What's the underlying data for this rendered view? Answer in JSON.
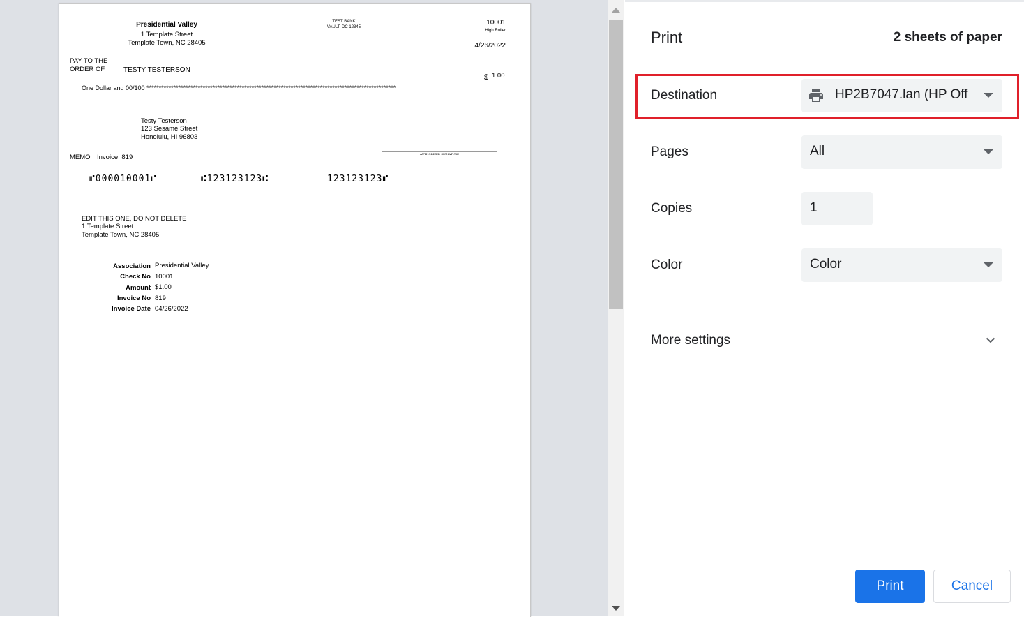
{
  "preview": {
    "association_name": "Presidential Valley",
    "association_street": "1 Template Street",
    "association_city": "Template Town, NC 28405",
    "bank_name": "TEST BANK",
    "bank_city": "VAULT, DC 12345",
    "check_number": "10001",
    "account_note": "High Roller",
    "date": "4/26/2022",
    "pay_to_line1": "PAY TO THE",
    "pay_to_line2": "ORDER OF",
    "payee": "TESTY TESTERSON",
    "dollar_sign": "$",
    "amount": "1.00",
    "amount_words": "One Dollar and 00/100 ******************************************************************************************************",
    "payee_name": "Testy Testerson",
    "payee_street": "123 Sesame Street",
    "payee_city": "Honolulu, HI 96803",
    "memo_label": "MEMO",
    "memo_value": "Invoice: 819",
    "signature_label": "AUTHORIZED SIGNATURE",
    "micr_check": "⑈000010001⑈",
    "micr_routing": "⑆123123123⑆",
    "micr_account": "123123123⑈",
    "stub_line1": "EDIT THIS ONE, DO NOT DELETE",
    "stub_line2": "1 Template Street",
    "stub_line3": "Template Town, NC 28405",
    "details": [
      {
        "label": "Association",
        "value": "Presidential Valley"
      },
      {
        "label": "Check No",
        "value": "10001"
      },
      {
        "label": "Amount",
        "value": "$1.00"
      },
      {
        "label": "Invoice No",
        "value": "819"
      },
      {
        "label": "Invoice Date",
        "value": "04/26/2022"
      }
    ]
  },
  "settings": {
    "title": "Print",
    "sheets": "2 sheets of paper",
    "destination_label": "Destination",
    "destination_value": "HP2B7047.lan (HP Off",
    "pages_label": "Pages",
    "pages_value": "All",
    "copies_label": "Copies",
    "copies_value": "1",
    "color_label": "Color",
    "color_value": "Color",
    "more_settings": "More settings",
    "print_button": "Print",
    "cancel_button": "Cancel"
  },
  "colors": {
    "accent": "#1a73e8",
    "highlight": "#e0202a",
    "preview_background": "#dee1e6"
  }
}
